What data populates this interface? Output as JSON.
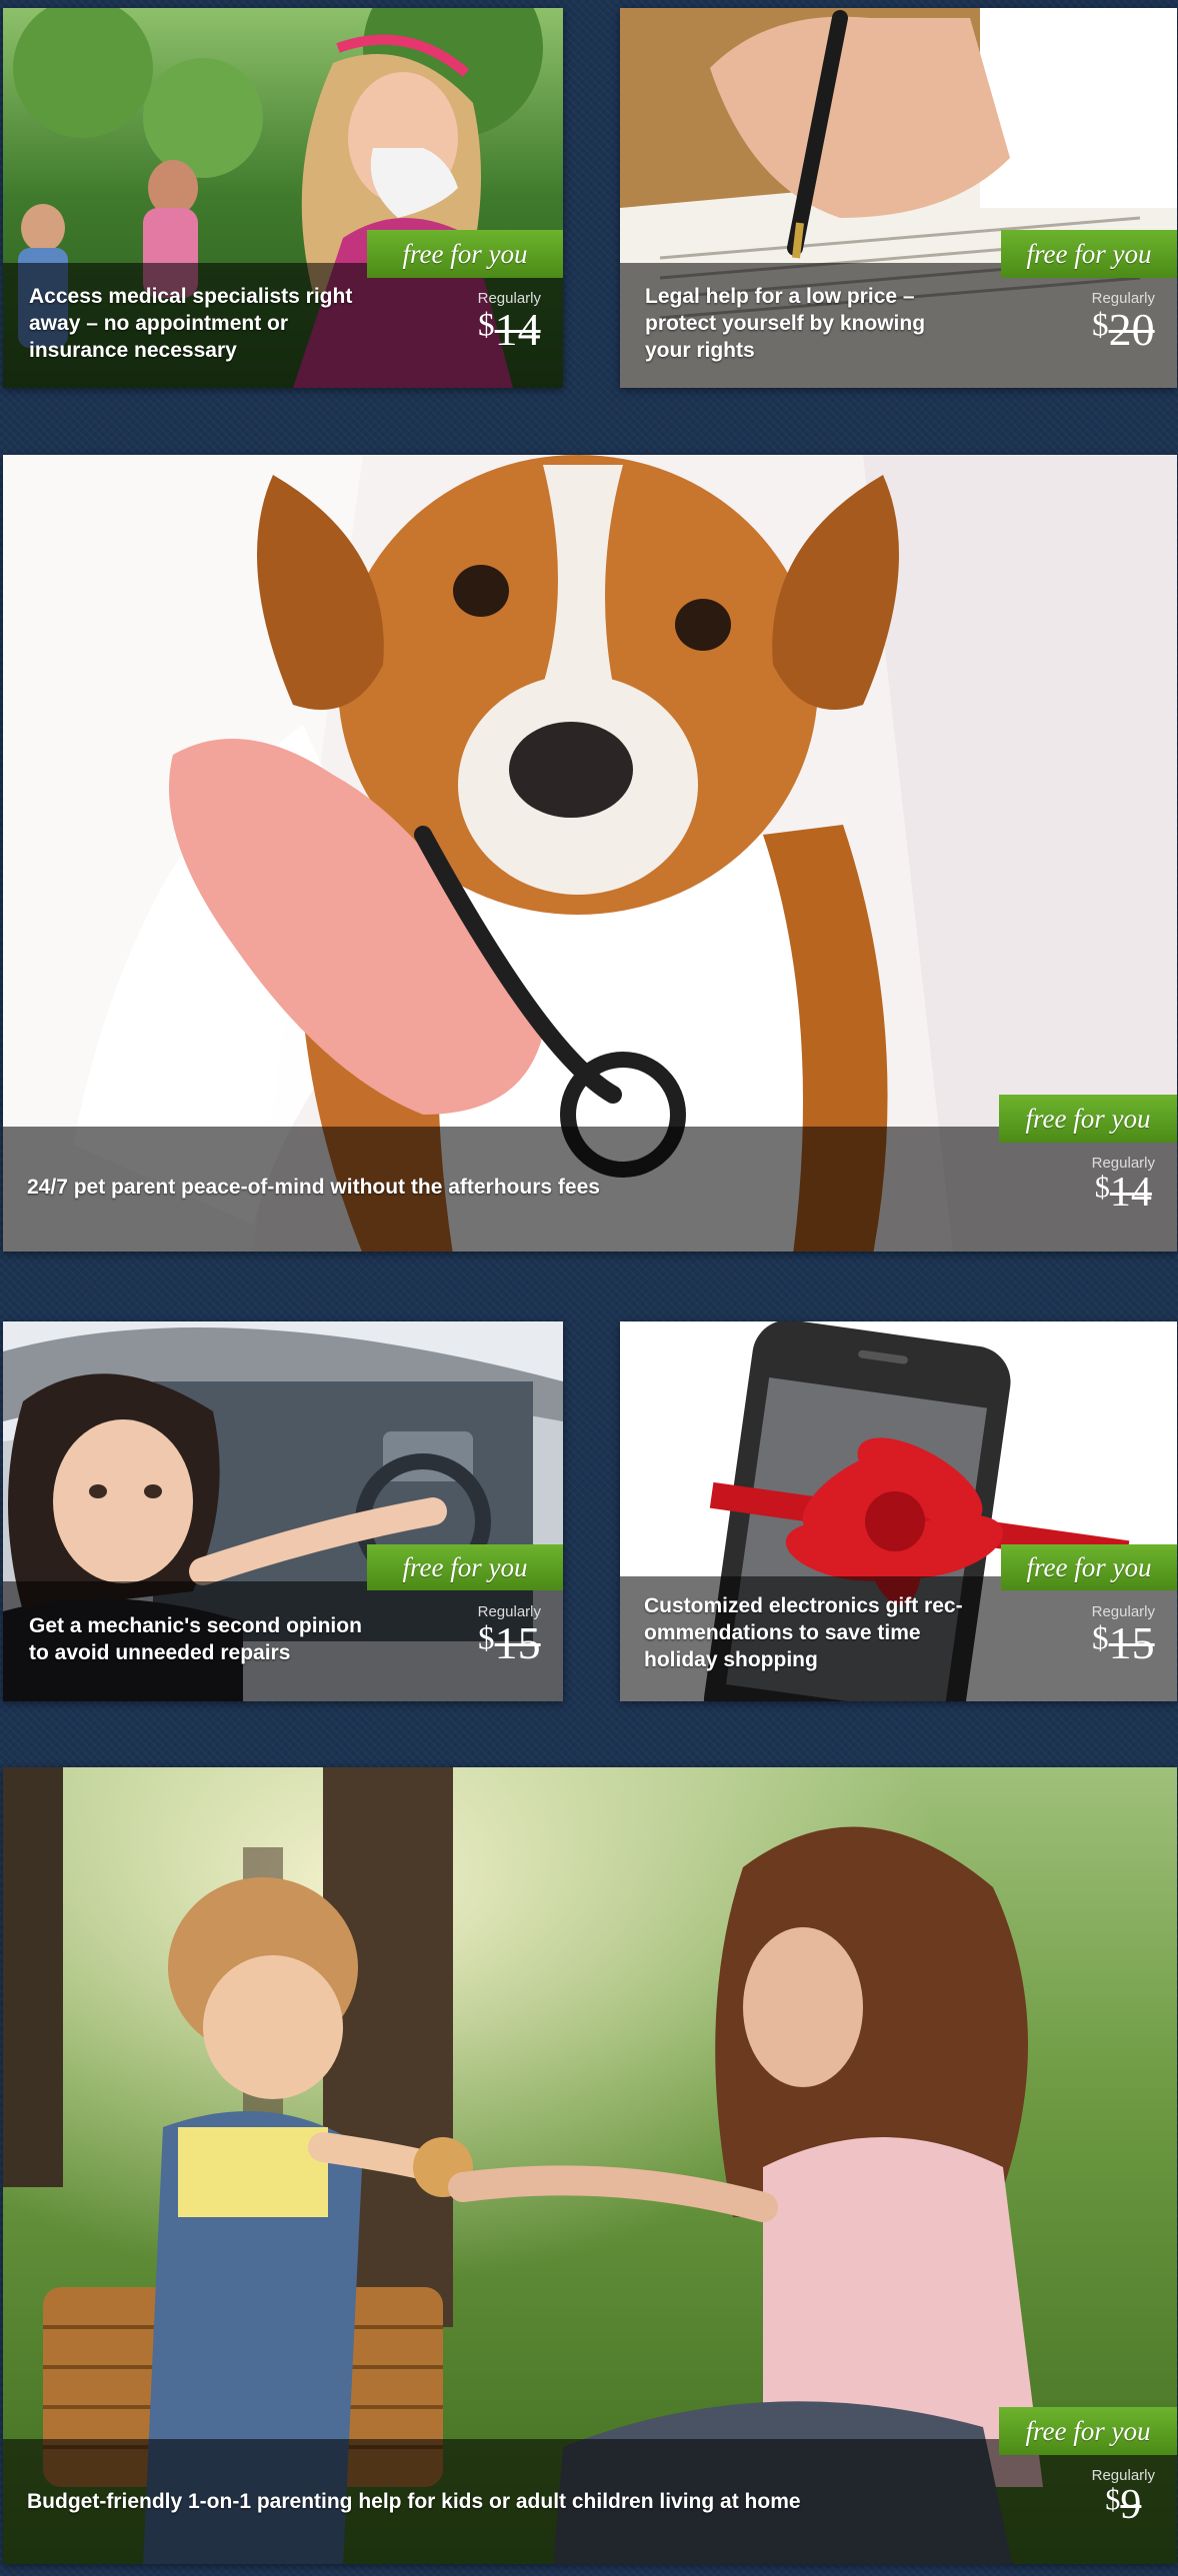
{
  "badge_color": "#5a9e22",
  "offers": [
    {
      "id": "medical",
      "badge": "free for you",
      "caption": "Access medical specialists right away – no appointment or insurance necessary",
      "caption_lines": [
        "Access medical specialists right",
        "away – no appointment or",
        "insurance necessary"
      ],
      "regularly": "Regularly",
      "price_currency": "$",
      "price_amount": "14"
    },
    {
      "id": "legal",
      "badge": "free for you",
      "caption_lines": [
        "Legal help for a low price –",
        "protect yourself by knowing",
        "your rights"
      ],
      "regularly": "Regularly",
      "price_currency": "$",
      "price_amount": "20"
    },
    {
      "id": "pet",
      "badge": "free for you",
      "caption_lines": [
        "24/7 pet parent peace-of-mind without the afterhours fees"
      ],
      "regularly": "Regularly",
      "price_currency": "$",
      "price_amount": "14"
    },
    {
      "id": "mechanic",
      "badge": "free for you",
      "caption_lines": [
        "Get a mechanic's second opinion",
        "to avoid unneeded repairs"
      ],
      "regularly": "Regularly",
      "price_currency": "$",
      "price_amount": "15"
    },
    {
      "id": "electronics",
      "badge": "free for you",
      "caption_lines": [
        "Customized electronics gift rec-",
        "ommendations to save time",
        "holiday shopping"
      ],
      "regularly": "Regularly",
      "price_currency": "$",
      "price_amount": "15"
    },
    {
      "id": "parenting",
      "badge": "free for you",
      "caption_lines": [
        "Budget-friendly 1-on-1 parenting help for kids or adult children living at home"
      ],
      "regularly": "Regularly",
      "price_currency": "$",
      "price_amount": "9"
    }
  ]
}
